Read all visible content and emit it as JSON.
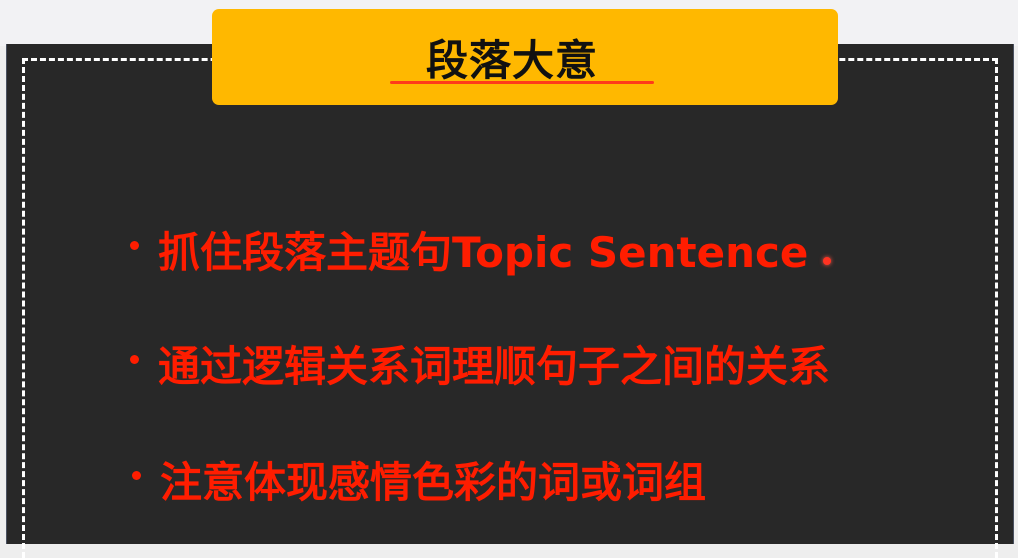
{
  "slide": {
    "title": "段落大意",
    "bullets": [
      "抓住段落主题句Topic Sentence",
      "通过逻辑关系词理顺句子之间的关系",
      "注意体现感情色彩的词或词组"
    ],
    "colors": {
      "panel_background": "#282828",
      "title_background": "#ffb800",
      "bullet_text": "#ff1d00",
      "frame": "#ffffff"
    }
  }
}
